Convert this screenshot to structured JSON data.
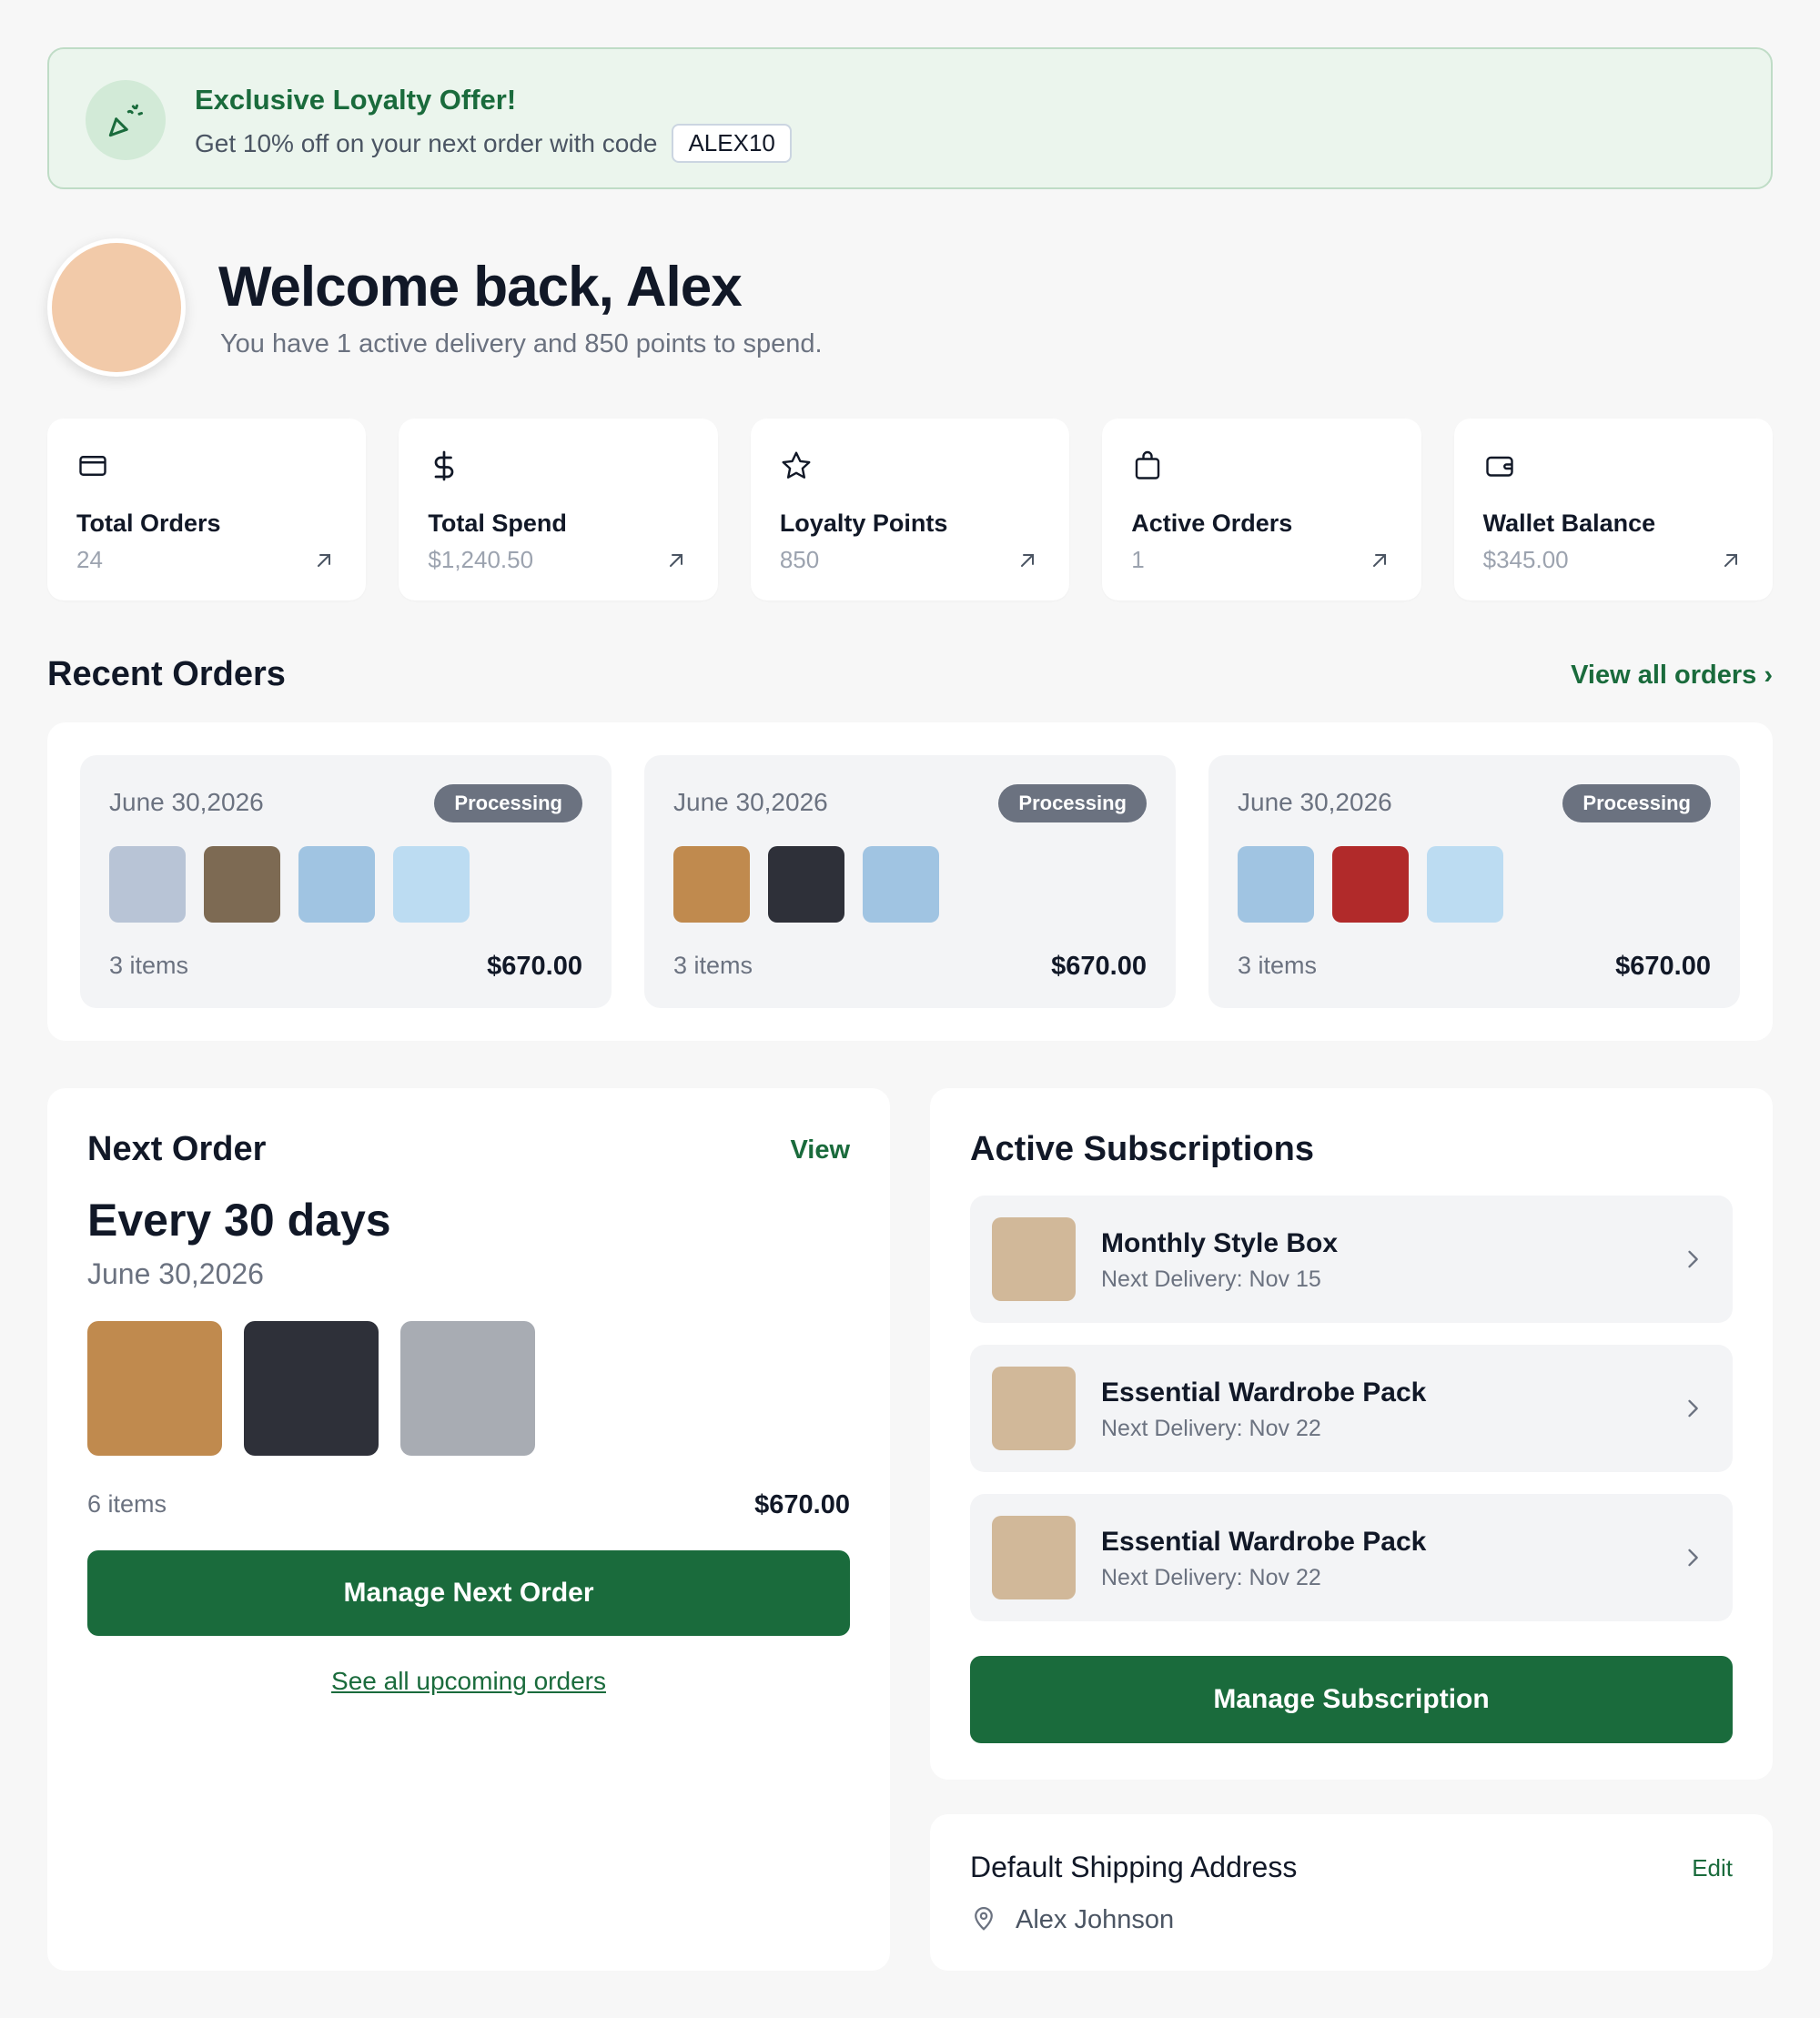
{
  "promo": {
    "title": "Exclusive Loyalty Offer!",
    "text": "Get 10% off on your next order with code",
    "code": "ALEX10",
    "icon": "party-popper-icon"
  },
  "welcome": {
    "title": "Welcome back, Alex",
    "subtitle": "You have 1 active delivery and 850 points to spend."
  },
  "stats": [
    {
      "label": "Total Orders",
      "value": "24",
      "icon": "credit-card-icon"
    },
    {
      "label": "Total Spend",
      "value": "$1,240.50",
      "icon": "dollar-icon"
    },
    {
      "label": "Loyalty Points",
      "value": "850",
      "icon": "star-icon"
    },
    {
      "label": "Active Orders",
      "value": "1",
      "icon": "shopping-bag-icon"
    },
    {
      "label": "Wallet Balance",
      "value": "$345.00",
      "icon": "wallet-icon"
    }
  ],
  "recent_orders": {
    "title": "Recent Orders",
    "view_all": "View all orders ›",
    "orders": [
      {
        "date": "June 30,2026",
        "status": "Processing",
        "items": "3 items",
        "total": "$670.00",
        "colors": [
          "#b8c4d6",
          "#7d6a53",
          "#a0c4e2",
          "#bcdcf2"
        ]
      },
      {
        "date": "June 30,2026",
        "status": "Processing",
        "items": "3 items",
        "total": "$670.00",
        "colors": [
          "#c08a4e",
          "#2e3039",
          "#a0c4e2"
        ]
      },
      {
        "date": "June 30,2026",
        "status": "Processing",
        "items": "3 items",
        "total": "$670.00",
        "colors": [
          "#a0c4e2",
          "#b12a2a",
          "#bcdcf2"
        ]
      }
    ]
  },
  "next_order": {
    "title": "Next Order",
    "view": "View",
    "frequency": "Every 30 days",
    "date": "June 30,2026",
    "colors": [
      "#c08a4e",
      "#2e3039",
      "#a8acb3"
    ],
    "items": "6 items",
    "total": "$670.00",
    "manage_button": "Manage Next Order",
    "see_all": "See all upcoming orders"
  },
  "subscriptions": {
    "title": "Active Subscriptions",
    "items": [
      {
        "name": "Monthly Style Box",
        "next": "Next Delivery: Nov 15"
      },
      {
        "name": "Essential Wardrobe Pack",
        "next": "Next Delivery: Nov 22"
      },
      {
        "name": "Essential Wardrobe Pack",
        "next": "Next Delivery: Nov 22"
      }
    ],
    "manage_button": "Manage Subscription"
  },
  "shipping": {
    "title": "Default Shipping Address",
    "edit": "Edit",
    "name": "Alex Johnson"
  },
  "colors": {
    "accent": "#1a6b3c",
    "banner_bg": "#ebf5ed",
    "badge": "#6b7280",
    "avatar": "#f2caa9",
    "sub_thumb": "#d1b899"
  }
}
